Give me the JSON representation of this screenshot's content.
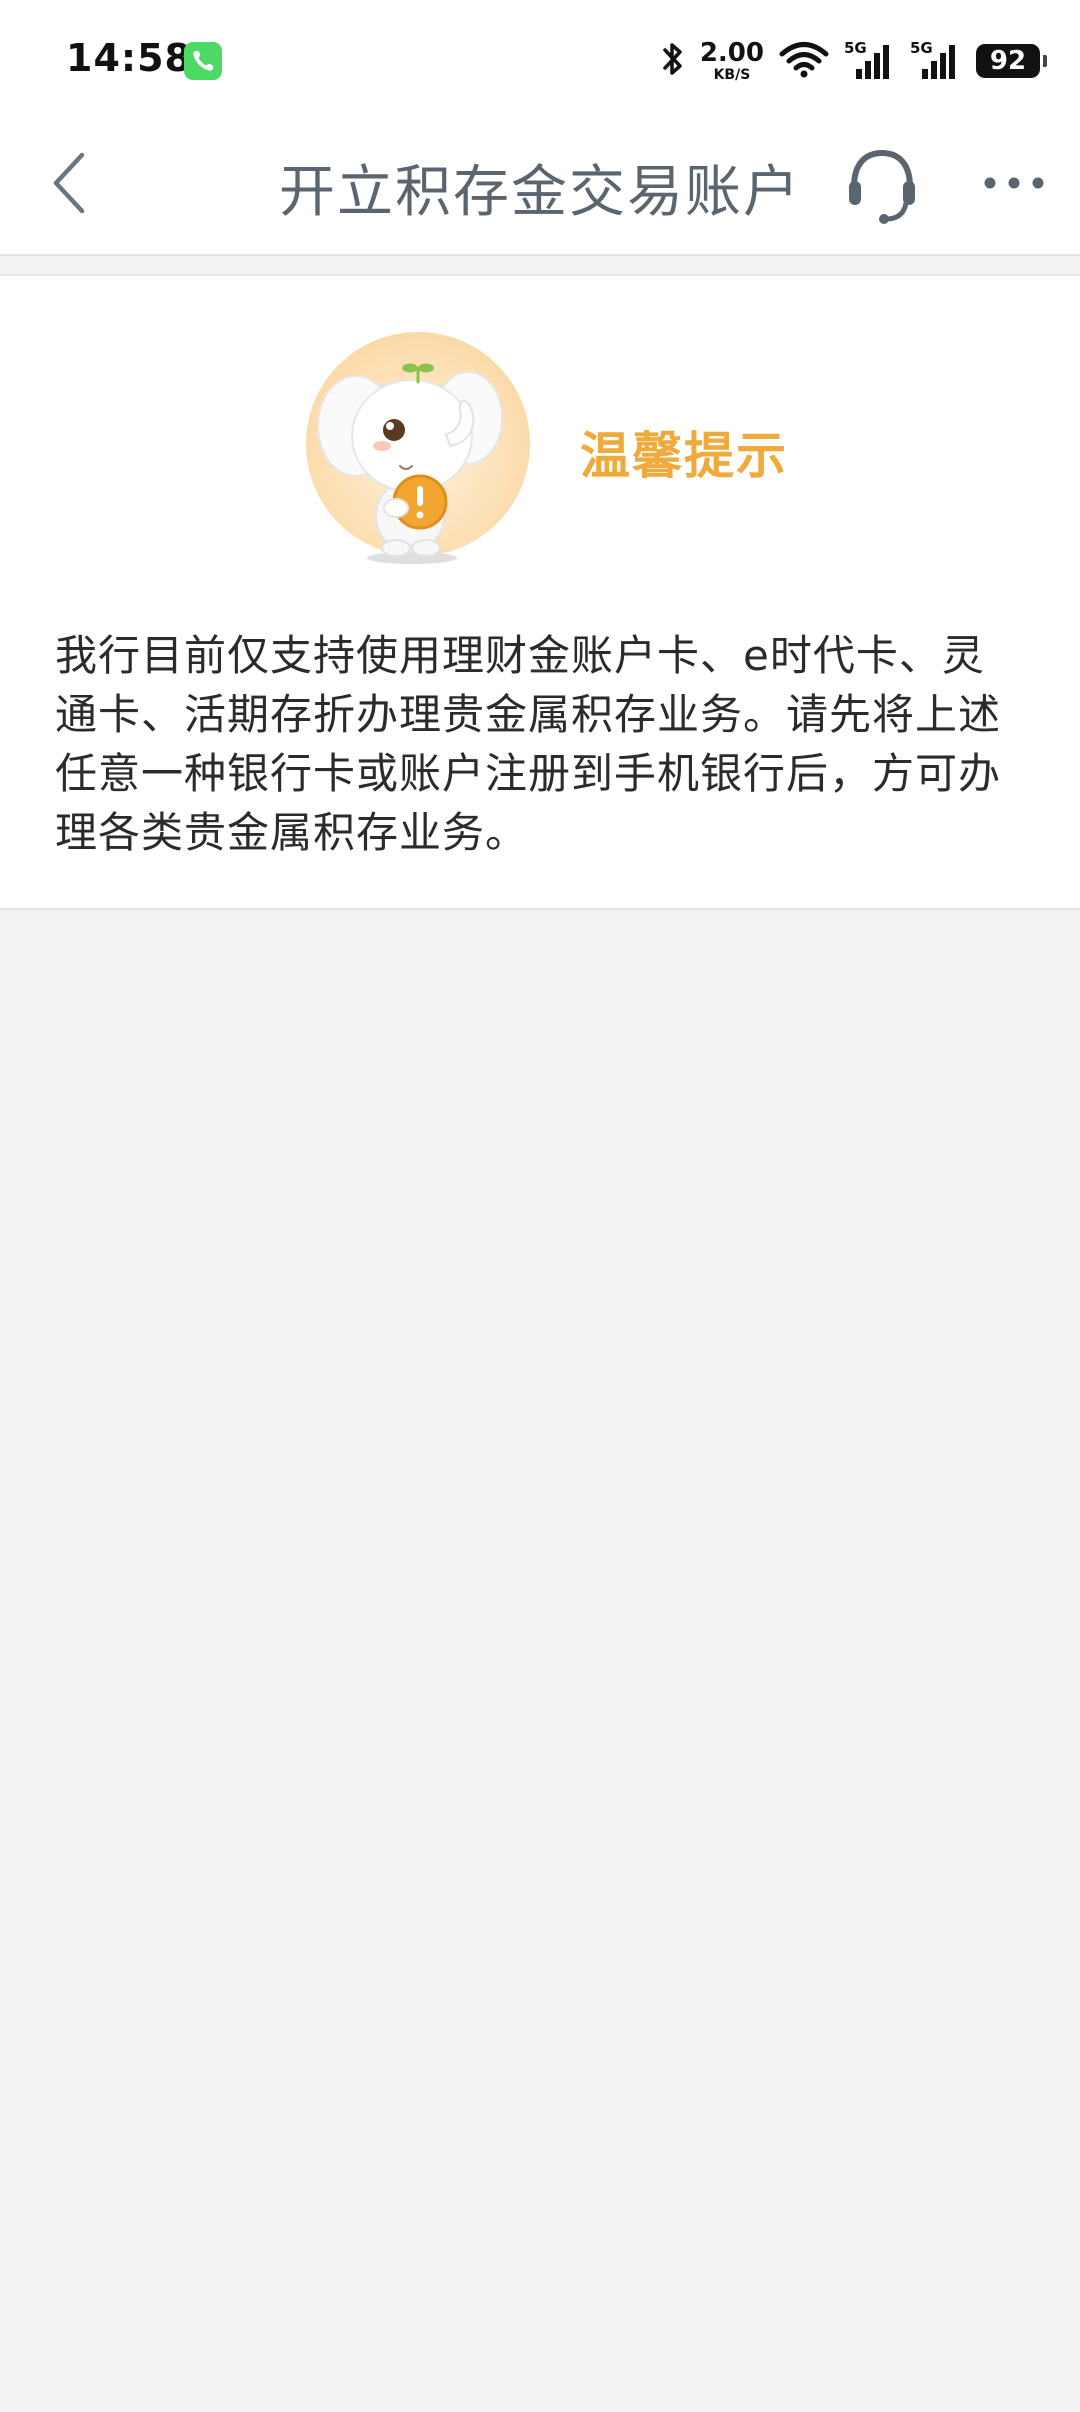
{
  "status_bar": {
    "time": "14:58",
    "net_speed_value": "2.00",
    "net_speed_unit": "KB/S",
    "signal_1_label": "5G",
    "signal_2_label": "5G",
    "battery": "92",
    "icons": [
      "phone-call-icon",
      "bluetooth-icon",
      "wifi-icon",
      "signal-icon",
      "battery-icon"
    ]
  },
  "header": {
    "title": "开立积存金交易账户",
    "icons": [
      "back-arrow-icon",
      "headset-icon",
      "more-icon"
    ]
  },
  "notice": {
    "title": "温馨提示",
    "mascot": "elephant-mascot-icon",
    "message": "我行目前仅支持使用理财金账户卡、e时代卡、灵通卡、活期存折办理贵金属积存业务。请先将上述任意一种银行卡或账户注册到手机银行后，方可办理各类贵金属积存业务。"
  },
  "colors": {
    "accent": "#f0a93b",
    "title_text": "#5a6570",
    "page_background": "#f3f3f3"
  }
}
